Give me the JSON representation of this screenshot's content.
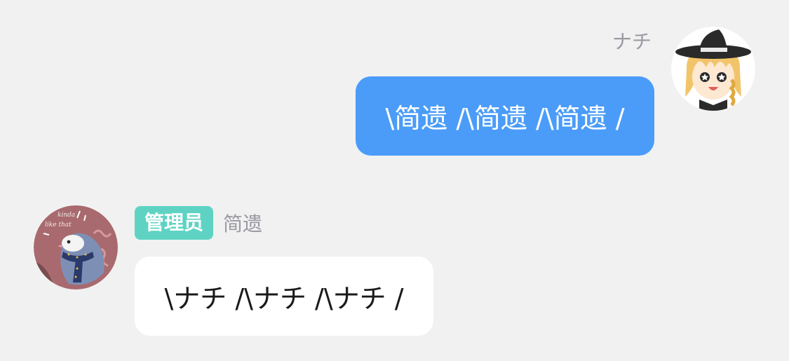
{
  "messages": [
    {
      "direction": "outgoing",
      "sender": "ナチ",
      "avatar_icon": "blonde-witch-avatar-icon",
      "text": "\\简遗 /\\简遗 /\\简遗 /",
      "bubble_color": "#4a9cf8"
    },
    {
      "direction": "incoming",
      "sender": "简遗",
      "role_badge": "管理员",
      "role_badge_color": "#5fd3c3",
      "avatar_icon": "bird-scarf-avatar-icon",
      "avatar_text": "kinda like that",
      "text": "\\ナチ /\\ナチ /\\ナチ /",
      "bubble_color": "#ffffff"
    }
  ]
}
